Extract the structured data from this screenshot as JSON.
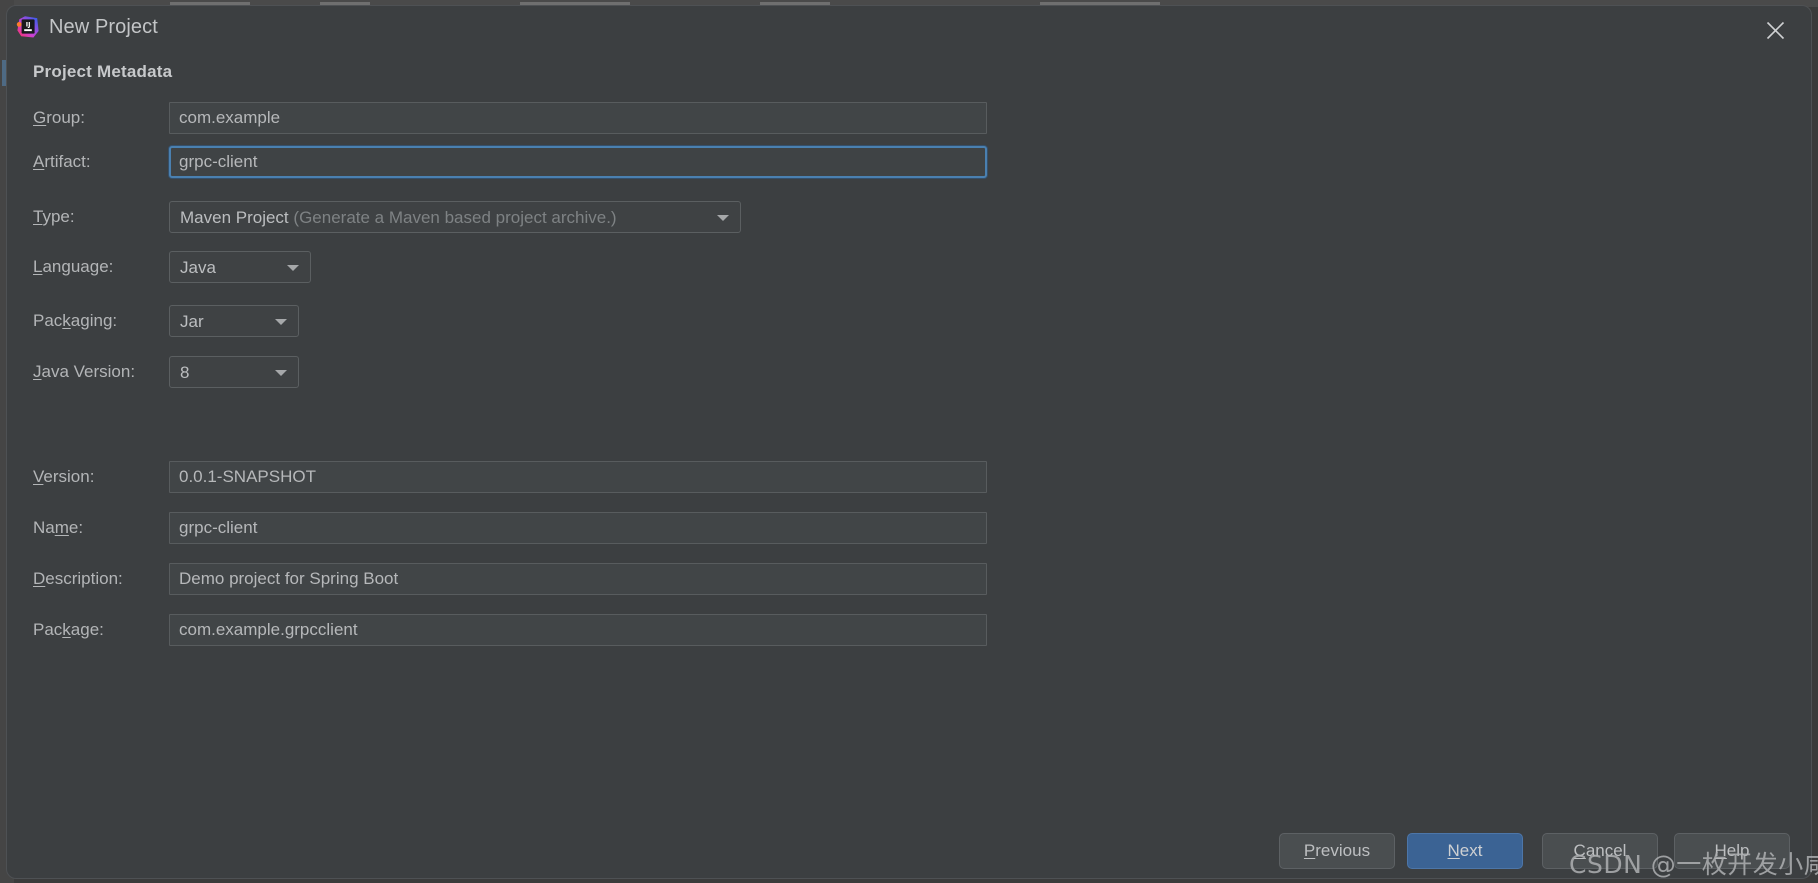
{
  "window": {
    "title": "New Project",
    "app_icon": "intellij-idea-logo",
    "close_icon": "close-icon",
    "background_color": "#3c3f41",
    "accent_color": "#3b6394",
    "focus_border_color": "#4a80b0"
  },
  "form": {
    "section_title": "Project Metadata",
    "rows": [
      {
        "name": "group",
        "label_pre": "",
        "label_mnemonic": "G",
        "label_post": "roup:",
        "control": "text",
        "value": "com.example"
      },
      {
        "name": "artifact",
        "label_pre": "",
        "label_mnemonic": "A",
        "label_post": "rtifact:",
        "control": "text",
        "value": "grpc-client",
        "focused": true
      },
      {
        "name": "type",
        "label_pre": "",
        "label_mnemonic": "T",
        "label_post": "ype:",
        "control": "combo",
        "value": "Maven Project",
        "hint": "(Generate a Maven based project archive.)"
      },
      {
        "name": "language",
        "label_pre": "",
        "label_mnemonic": "L",
        "label_post": "anguage:",
        "control": "combo",
        "value": "Java"
      },
      {
        "name": "packaging",
        "label_pre": "Pac",
        "label_mnemonic": "k",
        "label_post": "aging:",
        "control": "combo",
        "value": "Jar"
      },
      {
        "name": "java-version",
        "label_pre": "",
        "label_mnemonic": "J",
        "label_post": "ava Version:",
        "control": "combo",
        "value": "8"
      },
      {
        "name": "version",
        "label_pre": "",
        "label_mnemonic": "V",
        "label_post": "ersion:",
        "control": "text",
        "value": "0.0.1-SNAPSHOT"
      },
      {
        "name": "name",
        "label_pre": "Na",
        "label_mnemonic": "m",
        "label_post": "e:",
        "control": "text",
        "value": "grpc-client"
      },
      {
        "name": "description",
        "label_pre": "",
        "label_mnemonic": "D",
        "label_post": "escription:",
        "control": "text",
        "value": "Demo project for Spring Boot"
      },
      {
        "name": "package",
        "label_pre": "Pac",
        "label_mnemonic": "k",
        "label_post": "age:",
        "control": "text",
        "value": "com.example.grpcclient"
      }
    ]
  },
  "footer": {
    "buttons": [
      {
        "name": "previous",
        "pre": "",
        "mnemonic": "P",
        "post": "revious",
        "primary": false
      },
      {
        "name": "next",
        "pre": "",
        "mnemonic": "N",
        "post": "ext",
        "primary": true
      },
      {
        "name": "cancel",
        "pre": "",
        "mnemonic": "C",
        "post": "ancel",
        "primary": false
      },
      {
        "name": "help",
        "pre": "",
        "mnemonic": "H",
        "post": "elp",
        "primary": false
      }
    ]
  },
  "watermark": {
    "text": "CSDN @一枚开发小咸鱼"
  }
}
